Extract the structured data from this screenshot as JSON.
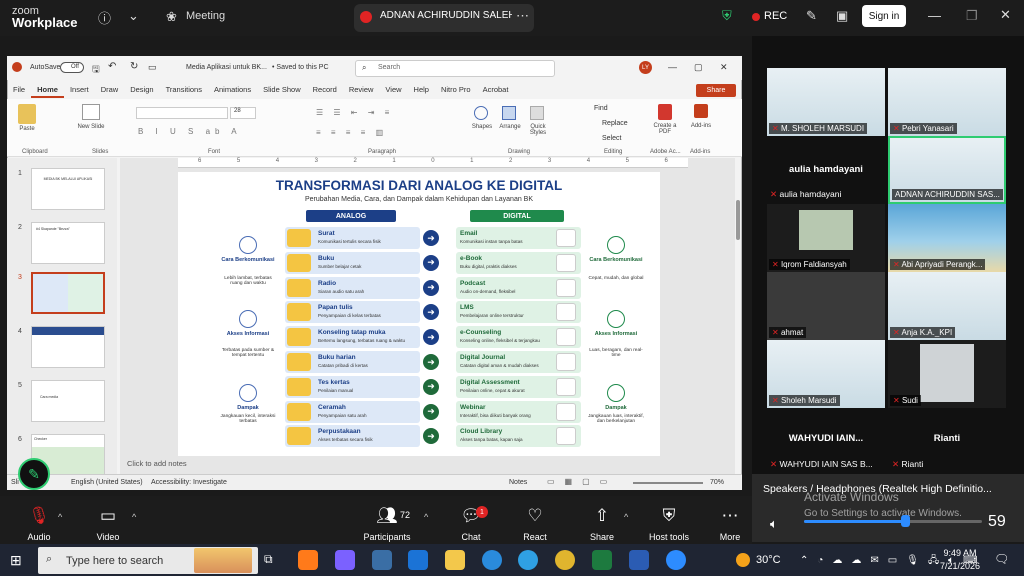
{
  "zoom": {
    "logo_line1": "zoom",
    "logo_line2": "Workplace",
    "meeting_label": "Meeting",
    "share_title": "ADNAN ACHIRUDDIN SALEH's sc",
    "rec_label": "REC",
    "sign_in": "Sign in"
  },
  "ppt": {
    "autosave": "AutoSave",
    "autosave_state": "Off",
    "doc_title": "Media Aplikasi untuk BK...",
    "saved_state": "• Saved to this PC",
    "search_placeholder": "Search",
    "user_initials": "LY",
    "share_label": "Share",
    "menus": [
      "File",
      "Home",
      "Insert",
      "Draw",
      "Design",
      "Transitions",
      "Animations",
      "Slide Show",
      "Record",
      "Review",
      "View",
      "Help",
      "Nitro Pro",
      "Acrobat"
    ],
    "ribbon": {
      "paste": "Paste",
      "clipboard": "Clipboard",
      "new_slide": "New Slide",
      "slides": "Slides",
      "font_size": "28",
      "font": "Font",
      "paragraph": "Paragraph",
      "shapes": "Shapes",
      "arrange": "Arrange",
      "quick_styles": "Quick Styles",
      "drawing": "Drawing",
      "find": "Find",
      "replace": "Replace",
      "select": "Select",
      "editing": "Editing",
      "create_pdf": "Create a PDF",
      "adobe": "Adobe Ac...",
      "addins": "Add-ins",
      "addins_grp": "Add-ins"
    },
    "thumb_numbers": [
      "1",
      "2",
      "3",
      "4",
      "5",
      "6"
    ],
    "thumb_texts": [
      "MEDIA BK MELALUI APLIKASI",
      "#4 Skapande \"Bezza\"",
      "",
      "",
      "Cara media",
      "Checker"
    ],
    "ruler_marks": [
      "6",
      "5",
      "4",
      "3",
      "2",
      "1",
      "0",
      "1",
      "2",
      "3",
      "4",
      "5",
      "6"
    ],
    "notes": "Click to add notes",
    "status": {
      "slide": "Sli",
      "lang": "English (United States)",
      "accessibility": "Accessibility: Investigate",
      "notes_btn": "Notes",
      "zoom": "70%"
    }
  },
  "slide": {
    "title": "TRANSFORMASI DARI ANALOG KE DIGITAL",
    "subtitle": "Perubahan Media, Cara, dan Dampak dalam Kehidupan dan Layanan BK",
    "analog_header": "ANALOG",
    "digital_header": "DIGITAL",
    "rows": [
      {
        "a_title": "Surat",
        "a_sub": "Komunikasi tertulis secara fisik",
        "d_title": "Email",
        "d_sub": "Komunikasi instan tanpa batas"
      },
      {
        "a_title": "Buku",
        "a_sub": "Sumber belajar cetak",
        "d_title": "e-Book",
        "d_sub": "Buku digital, praktis diakses"
      },
      {
        "a_title": "Radio",
        "a_sub": "Siaran audio satu arah",
        "d_title": "Podcast",
        "d_sub": "Audio on-demand, fleksibel"
      },
      {
        "a_title": "Papan tulis",
        "a_sub": "Penyampaian di kelas terbatas",
        "d_title": "LMS",
        "d_sub": "Pembelajaran online terstruktur"
      },
      {
        "a_title": "Konseling tatap muka",
        "a_sub": "Bertemu langsung, terbatas ruang & waktu",
        "d_title": "e-Counseling",
        "d_sub": "Konseling online, fleksibel & terjangkau"
      },
      {
        "a_title": "Buku harian",
        "a_sub": "Catatan pribadi di kertas",
        "d_title": "Digital Journal",
        "d_sub": "Catatan digital aman & mudah diakses"
      },
      {
        "a_title": "Tes kertas",
        "a_sub": "Penilaian manual",
        "d_title": "Digital Assessment",
        "d_sub": "Penilaian online, cepat & akurat"
      },
      {
        "a_title": "Ceramah",
        "a_sub": "Penyampaian satu arah",
        "d_title": "Webinar",
        "d_sub": "Interaktif, bisa diikuti banyak orang"
      },
      {
        "a_title": "Perpustakaan",
        "a_sub": "Akses terbatas secara fisik",
        "d_title": "Cloud Library",
        "d_sub": "Akses tanpa batas, kapan saja"
      }
    ],
    "left_side": [
      {
        "title": "Cara Berkomunikasi",
        "desc": "Lebih lambat, terbatas ruang dan waktu"
      },
      {
        "title": "Akses Informasi",
        "desc": "Terbatas pada sumber & tempat tertentu"
      },
      {
        "title": "Dampak",
        "desc": "Jangkauan kecil, interaksi terbatas"
      }
    ],
    "right_side": [
      {
        "title": "Cara Berkomunikasi",
        "desc": "Cepat, mudah, dan global"
      },
      {
        "title": "Akses Informasi",
        "desc": "Luas, beragam, dan real-time"
      },
      {
        "title": "Dampak",
        "desc": "Jangkauan luas, interaktif, dan berkelanjutan"
      }
    ]
  },
  "gallery": {
    "tiles": [
      {
        "name": "M. SHOLEH MARSUDI"
      },
      {
        "name": "Pebri Yanasari"
      },
      {
        "name": "aulia hamdayani"
      },
      {
        "name": "ADNAN ACHIRUDDIN SAS..."
      },
      {
        "name": "Iqrom Faldiansyah"
      },
      {
        "name": "Abi Apriyadi Perangk..."
      },
      {
        "name": "ahmat"
      },
      {
        "name": "Anja K.A._KPI"
      },
      {
        "name": "Sholeh Marsudi"
      },
      {
        "name": "Sudi"
      },
      {
        "name": "WAHYUDI IAIN SAS B..."
      },
      {
        "name": "Rianti"
      }
    ],
    "big_label_aulia": "aulia hamdayani",
    "big_label_wahyudi": "WAHYUDI IAIN...",
    "big_label_rianti": "Rianti"
  },
  "speaker": {
    "title": "Speakers / Headphones (Realtek High Definitio...",
    "volume": "59",
    "volume_level": 0.59,
    "activate1": "Activate Windows",
    "activate2": "Go to Settings to activate Windows."
  },
  "toolbar": {
    "audio": "Audio",
    "video": "Video",
    "participants": "Participants",
    "participants_count": "72",
    "chat": "Chat",
    "chat_badge": "1",
    "react": "React",
    "share": "Share",
    "host_tools": "Host tools",
    "more": "More"
  },
  "taskbar": {
    "search_placeholder": "Type here to search",
    "temperature": "30°C",
    "time": "9:49 AM",
    "date": "7/21/2026"
  }
}
